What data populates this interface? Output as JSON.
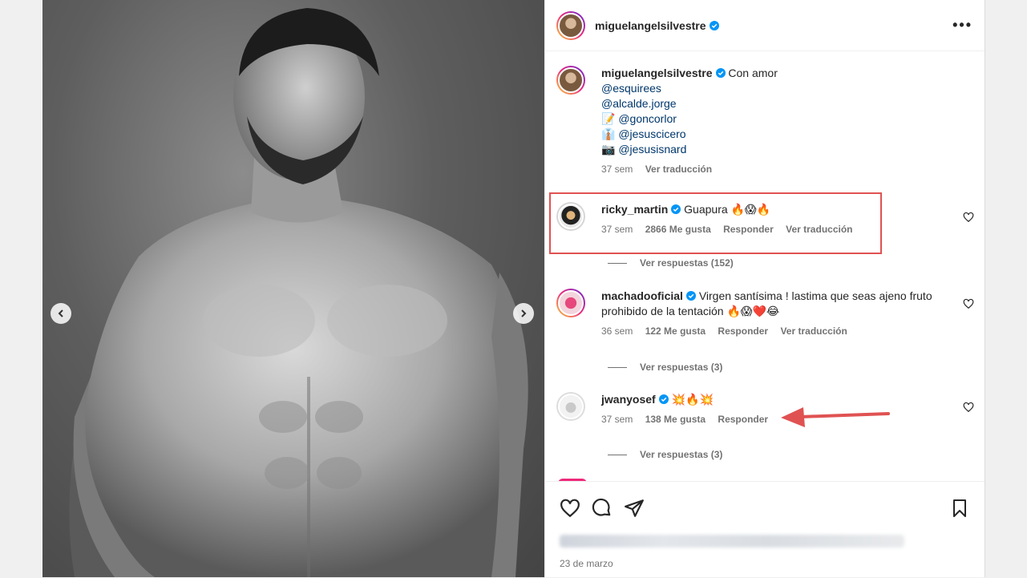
{
  "post": {
    "author": "miguelangelsilvestre",
    "caption": "Con amor",
    "mentions": [
      {
        "emoji": "",
        "handle": "@esquirees"
      },
      {
        "emoji": "",
        "handle": "@alcalde.jorge"
      },
      {
        "emoji": "📝",
        "handle": "@goncorlor"
      },
      {
        "emoji": "👔",
        "handle": "@jesuscicero"
      },
      {
        "emoji": "📷",
        "handle": "@jesusisnard"
      }
    ],
    "caption_time": "37 sem",
    "caption_translate": "Ver traducción",
    "date": "23 de marzo",
    "more_icon": "more-options-icon"
  },
  "comments": [
    {
      "user": "ricky_martin",
      "text": "Guapura 🔥😱🔥",
      "time": "37 sem",
      "likes": "2866 Me gusta",
      "reply": "Responder",
      "translate": "Ver traducción",
      "view_replies": "Ver respuestas (152)"
    },
    {
      "user": "machadooficial",
      "text": "Virgen santísima ! lastima que seas ajeno fruto prohibido de la tentación 🔥😱❤️😂",
      "time": "36 sem",
      "likes": "122 Me gusta",
      "reply": "Responder",
      "translate": "Ver traducción",
      "view_replies": "Ver respuestas (3)"
    },
    {
      "user": "jwanyosef",
      "text": "💥🔥💥",
      "time": "37 sem",
      "likes": "138 Me gusta",
      "reply": "Responder",
      "view_replies": "Ver respuestas (3)"
    }
  ],
  "colors": {
    "annotation_red": "#e05252",
    "verified_blue": "#0095f6",
    "mention_blue": "#00376b"
  },
  "icons": [
    "heart-icon",
    "comment-icon",
    "share-icon",
    "bookmark-icon",
    "chevron-left-icon",
    "chevron-right-icon",
    "verified-badge-icon"
  ]
}
